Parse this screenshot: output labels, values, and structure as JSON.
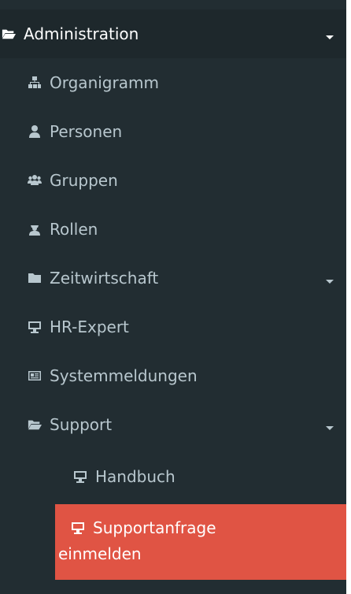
{
  "menu": {
    "header": {
      "label": "Administration",
      "icon": "folder-open-icon"
    },
    "items": [
      {
        "label": "Organigramm",
        "icon": "sitemap-icon"
      },
      {
        "label": "Personen",
        "icon": "user-icon"
      },
      {
        "label": "Gruppen",
        "icon": "users-icon"
      },
      {
        "label": "Rollen",
        "icon": "user-secret-icon"
      },
      {
        "label": "Zeitwirtschaft",
        "icon": "folder-icon"
      },
      {
        "label": "HR-Expert",
        "icon": "desktop-icon"
      },
      {
        "label": "Systemmeldungen",
        "icon": "id-card-icon"
      },
      {
        "label": "Support",
        "icon": "folder-open-icon"
      }
    ],
    "support_children": [
      {
        "label": "Handbuch",
        "icon": "desktop-icon"
      }
    ],
    "active": {
      "label_line1": "Supportanfrage",
      "label_line2": "einmelden",
      "icon": "desktop-icon"
    }
  },
  "colors": {
    "sidebar_bg": "#222d32",
    "header_bg": "#1e282c",
    "active_bg": "#e05444",
    "text": "#b8c7ce"
  }
}
